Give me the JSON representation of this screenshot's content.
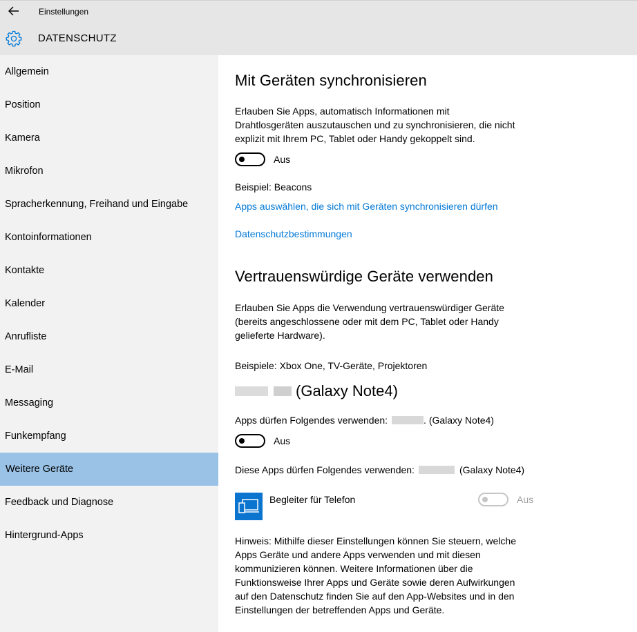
{
  "window": {
    "title": "Einstellungen"
  },
  "header": {
    "title": "DATENSCHUTZ"
  },
  "sidebar": {
    "items": [
      {
        "label": "Allgemein"
      },
      {
        "label": "Position"
      },
      {
        "label": "Kamera"
      },
      {
        "label": "Mikrofon"
      },
      {
        "label": "Spracherkennung, Freihand und Eingabe"
      },
      {
        "label": "Kontoinformationen"
      },
      {
        "label": "Kontakte"
      },
      {
        "label": "Kalender"
      },
      {
        "label": "Anrufliste"
      },
      {
        "label": "E-Mail"
      },
      {
        "label": "Messaging"
      },
      {
        "label": "Funkempfang"
      },
      {
        "label": "Weitere Geräte"
      },
      {
        "label": "Feedback und Diagnose"
      },
      {
        "label": "Hintergrund-Apps"
      }
    ],
    "selected": "Weitere Geräte"
  },
  "sync": {
    "heading": "Mit Geräten synchronisieren",
    "desc_line1": "Erlauben Sie Apps, automatisch Informationen mit",
    "desc_line2": "Drahtlosgeräten auszutauschen und zu synchronisieren, die nicht",
    "desc_line3": "explizit mit Ihrem PC, Tablet oder Handy gekoppelt sind.",
    "toggle_state": "Aus",
    "example": "Beispiel: Beacons",
    "link_choose": "Apps auswählen, die sich mit Geräten synchronisieren dürfen",
    "link_privacy": "Datenschutzbestimmungen"
  },
  "trusted": {
    "heading": "Vertrauenswürdige Geräte verwenden",
    "desc_line1": "Erlauben Sie Apps die Verwendung vertrauenswürdiger Geräte",
    "desc_line2": "(bereits angeschlossene oder mit dem PC, Tablet oder Handy",
    "desc_line3": "gelieferte Hardware).",
    "examples": "Beispiele: Xbox One, TV-Geräte, Projektoren",
    "device_name_suffix": "(Galaxy Note4)",
    "allow_prefix": "Apps dürfen Folgendes verwenden:",
    "allow_suffix": ". (Galaxy Note4)",
    "toggle_state": "Aus",
    "these_apps_prefix": "Diese Apps dürfen Folgendes verwenden:",
    "these_apps_suffix": "(Galaxy Note4)",
    "app_name": "Begleiter für Telefon",
    "app_toggle_state": "Aus",
    "note_line1": "Hinweis: Mithilfe dieser Einstellungen können Sie steuern, welche",
    "note_line2": "Apps Geräte und andere Apps verwenden und mit diesen",
    "note_line3": "kommunizieren können. Weitere Informationen über die",
    "note_line4": "Funktionsweise Ihrer Apps und Geräte sowie deren Aufwirkungen",
    "note_line5": "auf den Datenschutz finden Sie auf den App-Websites und in den",
    "note_line6": "Einstellungen der betreffenden Apps und Geräte."
  },
  "colors": {
    "accent": "#0078d7",
    "selected_nav": "#99c2e6",
    "sidebar_bg": "#f2f2f2",
    "header_bg": "#e6e6e6"
  },
  "icons": {
    "back": "back-arrow-icon",
    "settings": "gear-icon",
    "app": "phone-companion-icon"
  }
}
